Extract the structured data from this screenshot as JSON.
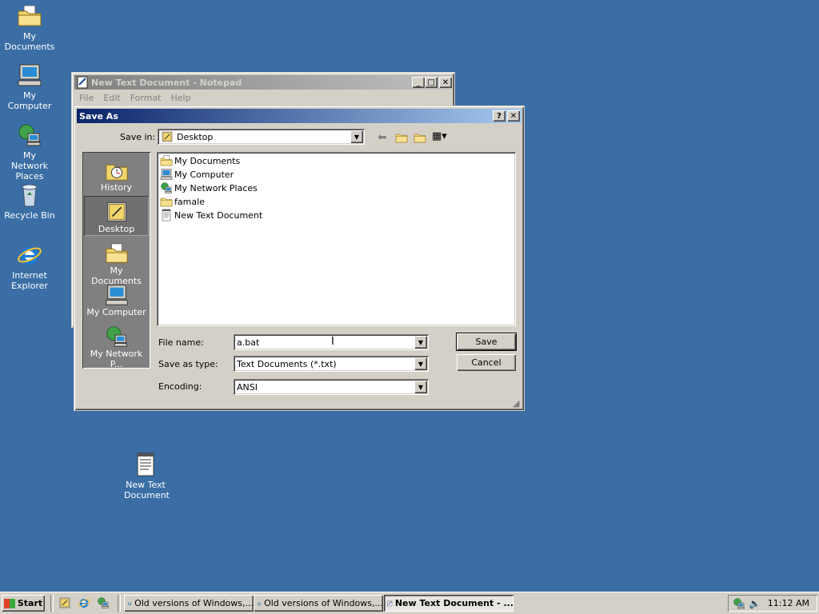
{
  "desktop": {
    "icons": [
      {
        "label": "My Documents"
      },
      {
        "label": "My Computer"
      },
      {
        "label": "My Network Places"
      },
      {
        "label": "Recycle Bin"
      },
      {
        "label": "Internet Explorer"
      },
      {
        "label": "New Text Document"
      }
    ]
  },
  "notepad": {
    "title": "New Text Document - Notepad",
    "menu": [
      "File",
      "Edit",
      "Format",
      "Help"
    ]
  },
  "dialog": {
    "title": "Save As",
    "save_in_label": "Save in:",
    "save_in_value": "Desktop",
    "places": [
      "History",
      "Desktop",
      "My Documents",
      "My Computer",
      "My Network P..."
    ],
    "files": [
      "My Documents",
      "My Computer",
      "My Network Places",
      "famale",
      "New Text Document"
    ],
    "file_name_label": "File name:",
    "file_name_value": "a.bat",
    "save_type_label": "Save as type:",
    "save_type_value": "Text Documents (*.txt)",
    "encoding_label": "Encoding:",
    "encoding_value": "ANSI",
    "save_button": "Save",
    "cancel_button": "Cancel"
  },
  "taskbar": {
    "start": "Start",
    "tasks": [
      "Old versions of Windows,...",
      "Old versions of Windows,...",
      "New Text Document - ..."
    ],
    "clock": "11:12 AM"
  }
}
